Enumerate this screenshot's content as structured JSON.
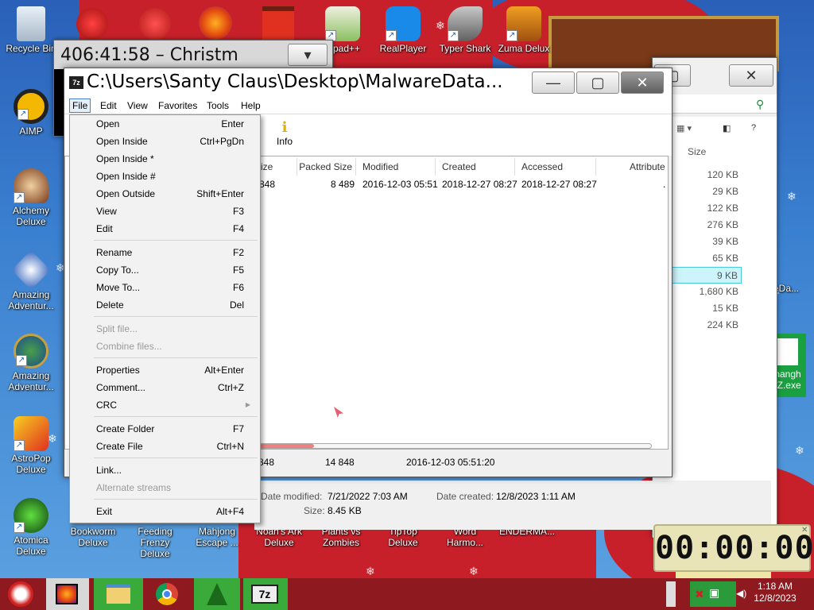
{
  "desktop": {
    "icons_left": [
      {
        "label": "Recycle Bin",
        "icon": "recycle-bin-icon"
      },
      {
        "label": "AIMP",
        "icon": "aimp-icon"
      },
      {
        "label": "Alchemy Deluxe",
        "icon": "alchemy-icon"
      },
      {
        "label": "Amazing Adventur...",
        "icon": "amazing-adventures-icon"
      },
      {
        "label": "Amazing Adventur...",
        "icon": "amazing-adventures-2-icon"
      },
      {
        "label": "AstroPop Deluxe",
        "icon": "astropop-icon"
      },
      {
        "label": "Atomica Deluxe",
        "icon": "atomica-icon"
      }
    ],
    "icons_top": [
      {
        "label": "tepad++",
        "icon": "notepad-plus-icon"
      },
      {
        "label": "RealPlayer",
        "icon": "realplayer-icon"
      },
      {
        "label": "Typer Shark",
        "icon": "typer-shark-icon"
      },
      {
        "label": "Zuma Delux",
        "icon": "zuma-icon"
      }
    ],
    "icons_bottom": [
      {
        "label": "Bookworm Deluxe",
        "icon": "bookworm-icon"
      },
      {
        "label": "Feeding Frenzy Deluxe",
        "icon": "feeding-frenzy-icon"
      },
      {
        "label": "Mahjong Escape ...",
        "icon": "mahjong-icon"
      },
      {
        "label": "Noah's Ark Deluxe",
        "icon": "noahs-ark-icon"
      },
      {
        "label": "Plants vs Zombies",
        "icon": "plants-vs-zombies-icon"
      },
      {
        "label": "TipTop Deluxe",
        "icon": "tiptop-icon"
      },
      {
        "label": "Word Harmo...",
        "icon": "word-harmony-icon"
      },
      {
        "label": "ENDERMA...",
        "icon": "enderman-icon"
      }
    ],
    "icons_right": [
      {
        "label": "reDa...",
        "icon": "malware-data-icon"
      },
      {
        "label": "nangh IZ.exe",
        "icon": "exe-file-icon"
      }
    ]
  },
  "back_window": {
    "countdown_text": "406:41:58 – Christm"
  },
  "explorer": {
    "size_header": "Size",
    "sizes": [
      "120 KB",
      "29 KB",
      "122 KB",
      "276 KB",
      "39 KB",
      "65 KB",
      "9 KB",
      "1,680 KB",
      "15 KB",
      "224 KB"
    ],
    "selected_index": 6,
    "details": {
      "modified_label": "Date modified:",
      "modified_value": "7/21/2022 7:03 AM",
      "created_label": "Date created:",
      "created_value": "12/8/2023 1:11 AM",
      "size_label": "Size:",
      "size_value": "8.45 KB"
    }
  },
  "zip_window": {
    "title": "C:\\Users\\Santy Claus\\Desktop\\MalwareData...",
    "menu": [
      "File",
      "Edit",
      "View",
      "Favorites",
      "Tools",
      "Help"
    ],
    "toolbar": {
      "info_label": "Info",
      "partial_label": "e"
    },
    "columns": [
      "ize",
      "Packed Size",
      "Modified",
      "Created",
      "Accessed",
      "Attribute"
    ],
    "row": {
      "size": "848",
      "packed": "8 489",
      "modified": "2016-12-03 05:51",
      "created": "2018-12-27 08:27",
      "accessed": "2018-12-27 08:27",
      "attr": "."
    },
    "status": {
      "size": "848",
      "packed": "14 848",
      "modified": "2016-12-03 05:51:20"
    }
  },
  "file_menu": {
    "items": [
      {
        "label": "Open",
        "shortcut": "Enter",
        "disabled": false
      },
      {
        "label": "Open Inside",
        "shortcut": "Ctrl+PgDn",
        "disabled": false
      },
      {
        "label": "Open Inside *",
        "shortcut": "",
        "disabled": false
      },
      {
        "label": "Open Inside #",
        "shortcut": "",
        "disabled": false
      },
      {
        "label": "Open Outside",
        "shortcut": "Shift+Enter",
        "disabled": false
      },
      {
        "label": "View",
        "shortcut": "F3",
        "disabled": false
      },
      {
        "label": "Edit",
        "shortcut": "F4",
        "disabled": false
      },
      {
        "label": "Rename",
        "shortcut": "F2",
        "disabled": false
      },
      {
        "label": "Copy To...",
        "shortcut": "F5",
        "disabled": false
      },
      {
        "label": "Move To...",
        "shortcut": "F6",
        "disabled": false
      },
      {
        "label": "Delete",
        "shortcut": "Del",
        "disabled": false
      },
      {
        "label": "Split file...",
        "shortcut": "",
        "disabled": true
      },
      {
        "label": "Combine files...",
        "shortcut": "",
        "disabled": true
      },
      {
        "label": "Properties",
        "shortcut": "Alt+Enter",
        "disabled": false
      },
      {
        "label": "Comment...",
        "shortcut": "Ctrl+Z",
        "disabled": false
      },
      {
        "label": "CRC",
        "shortcut": "",
        "disabled": false
      },
      {
        "label": "Create Folder",
        "shortcut": "F7",
        "disabled": false
      },
      {
        "label": "Create File",
        "shortcut": "Ctrl+N",
        "disabled": false
      },
      {
        "label": "Link...",
        "shortcut": "",
        "disabled": false
      },
      {
        "label": "Alternate streams",
        "shortcut": "",
        "disabled": true
      },
      {
        "label": "Exit",
        "shortcut": "Alt+F4",
        "disabled": false
      }
    ]
  },
  "timer_widget": {
    "display": "00:00:00"
  },
  "taskbar": {
    "apps": [
      "santa-start-icon",
      "firefox-icon",
      "file-explorer-icon",
      "chrome-icon",
      "tree-app-icon",
      "7zip-icon"
    ],
    "time": "1:18 AM",
    "date": "12/8/2023"
  },
  "colors": {
    "taskbar": "#8e1a1f",
    "menu_highlight": "#4a80c8",
    "selection": "#7fe0ee"
  }
}
